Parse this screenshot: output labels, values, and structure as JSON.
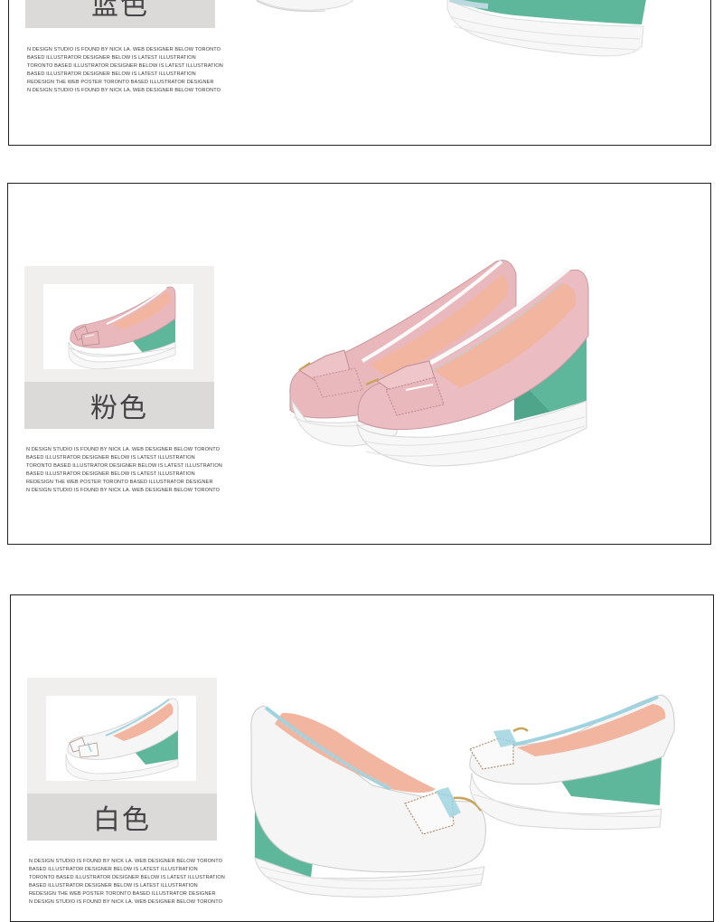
{
  "sections": [
    {
      "id": "blue",
      "color_label": "蓝色",
      "shoe_upper_color": "#bcd9e0",
      "desc_lines": [
        "N DESIGN STUDIO IS FOUND BY NICK LA. WEB DESIGNER BELOW TORONTO",
        "BASED ILLUSTRATOR DESIGNER BELOW IS LATEST ILLUSTRATION",
        "TORONTO BASED ILLUSTRATOR DESIGNER BELOW IS LATEST ILLUSTRATION",
        "BASED ILLUSTRATOR DESIGNER BELOW IS LATEST ILLUSTRATION",
        "REDESIGN THE WEB POSTER TORONTO BASED ILLUSTRATOR DESIGNER",
        "N DESIGN STUDIO IS FOUND BY NICK LA. WEB DESIGNER BELOW TORONTO"
      ]
    },
    {
      "id": "pink",
      "color_label": "粉色",
      "shoe_upper_color": "#e9b8bd",
      "desc_lines": [
        "N DESIGN STUDIO IS FOUND BY NICK LA. WEB DESIGNER BELOW TORONTO",
        "BASED ILLUSTRATOR DESIGNER BELOW IS LATEST ILLUSTRATION",
        "TORONTO BASED ILLUSTRATOR DESIGNER BELOW IS LATEST ILLUSTRATION",
        "BASED ILLUSTRATOR DESIGNER BELOW IS LATEST ILLUSTRATION",
        "REDESIGN THE WEB POSTER TORONTO BASED ILLUSTRATOR DESIGNER",
        "N DESIGN STUDIO IS FOUND BY NICK LA. WEB DESIGNER BELOW TORONTO"
      ]
    },
    {
      "id": "white",
      "color_label": "白色",
      "shoe_upper_color": "#f3f3f3",
      "desc_lines": [
        "N DESIGN STUDIO IS FOUND BY NICK LA. WEB DESIGNER BELOW TORONTO",
        "BASED ILLUSTRATOR DESIGNER BELOW IS LATEST ILLUSTRATION",
        "TORONTO BASED ILLUSTRATOR DESIGNER BELOW IS LATEST ILLUSTRATION",
        "BASED ILLUSTRATOR DESIGNER BELOW IS LATEST ILLUSTRATION",
        "REDESIGN THE WEB POSTER TORONTO BASED ILLUSTRATOR DESIGNER",
        "N DESIGN STUDIO IS FOUND BY NICK LA. WEB DESIGNER BELOW TORONTO"
      ]
    }
  ],
  "colors": {
    "wedge_green": "#5fb79b",
    "sole_white": "#f7f7f7",
    "lining_pink": "#f2b59f",
    "piping_blue": "#9fd3df"
  }
}
